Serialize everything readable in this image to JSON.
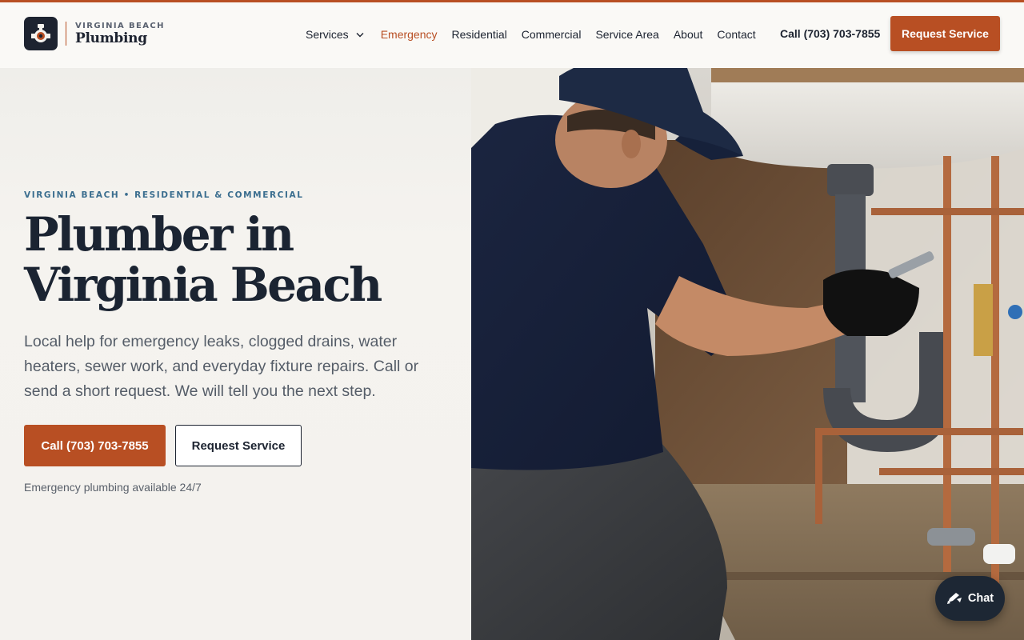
{
  "brand": {
    "small": "VIRGINIA BEACH",
    "big": "Plumbing",
    "accent": "#b84f23",
    "dark": "#1d2330"
  },
  "nav": {
    "items": [
      {
        "label": "Services",
        "has_dropdown": true
      },
      {
        "label": "Emergency",
        "active": true
      },
      {
        "label": "Residential"
      },
      {
        "label": "Commercial"
      },
      {
        "label": "Service Area"
      },
      {
        "label": "About"
      },
      {
        "label": "Contact"
      }
    ],
    "phone": "Call (703) 703-7855",
    "cta": "Request Service"
  },
  "hero": {
    "eyebrow": "VIRGINIA BEACH • RESIDENTIAL & COMMERCIAL",
    "title_line1": "Plumber in",
    "title_line2": "Virginia Beach",
    "lead": "Local help for emergency leaks, clogged drains, water heaters, sewer work, and everyday fixture repairs. Call or send a short request. We will tell you the next step.",
    "primary_button": "Call (703) 703-7855",
    "secondary_button": "Request Service",
    "note": "Emergency plumbing available 24/7",
    "eyebrow_color": "#3b6e8f"
  },
  "chat": {
    "label": "Chat",
    "icon": "chat-edit-icon"
  }
}
